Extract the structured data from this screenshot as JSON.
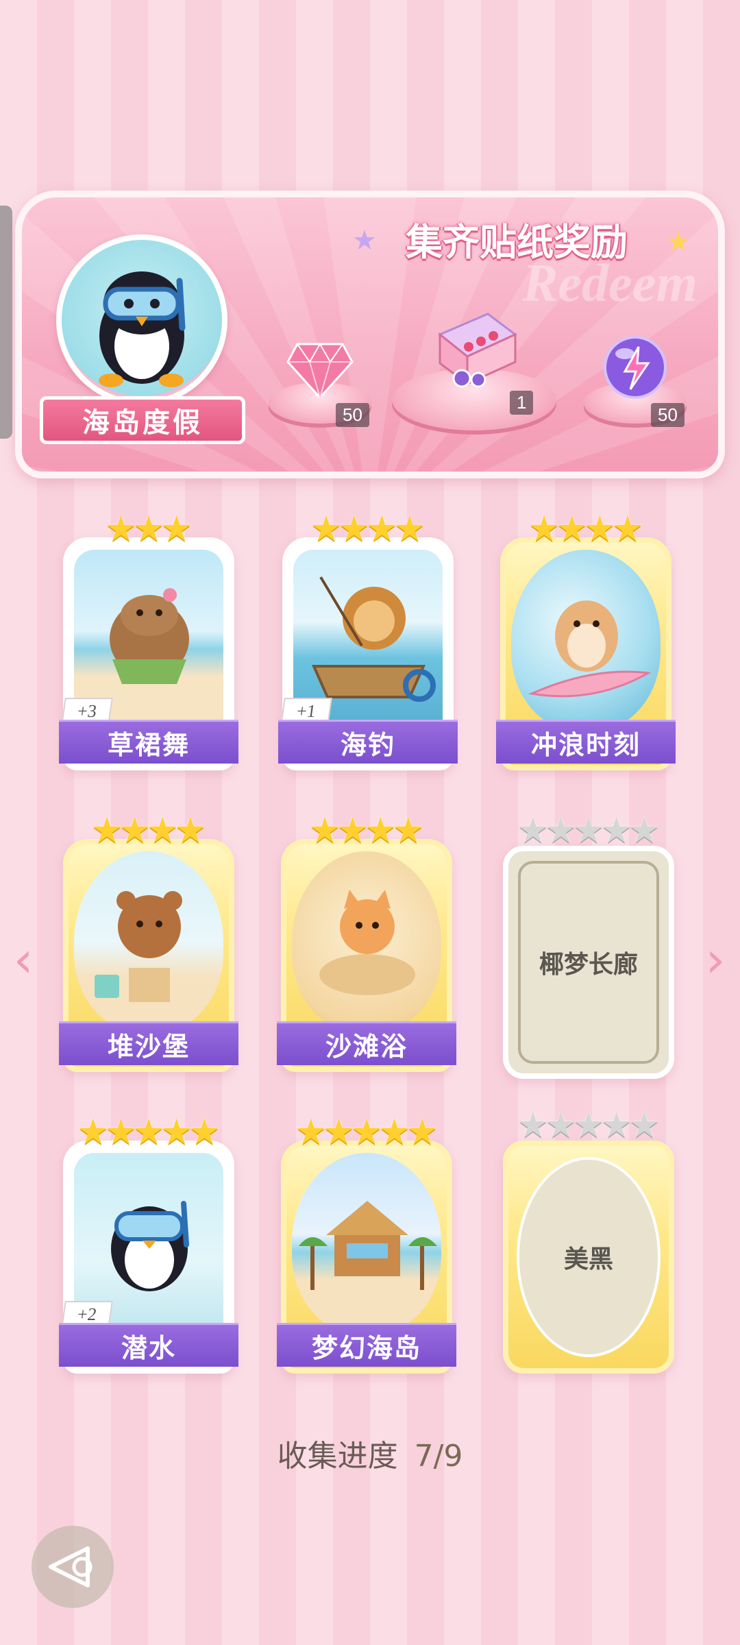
{
  "banner": {
    "title": "集齐贴纸奖励",
    "watermark": "Redeem",
    "theme_label": "海岛度假",
    "rewards": [
      {
        "name": "pink-diamond-icon",
        "count": "50"
      },
      {
        "name": "gift-box-icon",
        "count": "1"
      },
      {
        "name": "lightning-orb-icon",
        "count": "50"
      }
    ]
  },
  "stickers": [
    {
      "label": "草裙舞",
      "stars": 3,
      "count": "+3",
      "style": "white",
      "art": "capybara-hula"
    },
    {
      "label": "海钓",
      "stars": 4,
      "count": "+1",
      "style": "white",
      "art": "lion-fishing"
    },
    {
      "label": "冲浪时刻",
      "stars": 4,
      "count": "",
      "style": "gold",
      "art": "hamster-surfing"
    },
    {
      "label": "堆沙堡",
      "stars": 4,
      "count": "",
      "style": "gold",
      "art": "bear-sandcastle"
    },
    {
      "label": "沙滩浴",
      "stars": 4,
      "count": "",
      "style": "gold",
      "art": "cat-sandbath"
    },
    {
      "label": "椰梦长廊",
      "stars": 5,
      "locked": true,
      "style": "frame"
    },
    {
      "label": "潜水",
      "stars": 5,
      "count": "+2",
      "style": "white",
      "art": "penguin-diving"
    },
    {
      "label": "梦幻海岛",
      "stars": 5,
      "count": "",
      "style": "gold",
      "art": "beach-hut"
    },
    {
      "label": "美黑",
      "stars": 5,
      "locked": true,
      "style": "oval"
    }
  ],
  "progress": {
    "label": "收集进度",
    "value": "7/9",
    "fraction": 0.778
  },
  "colors": {
    "accent": "#7b4fce",
    "star": "#ffd02e",
    "pink": "#f49bb5"
  }
}
